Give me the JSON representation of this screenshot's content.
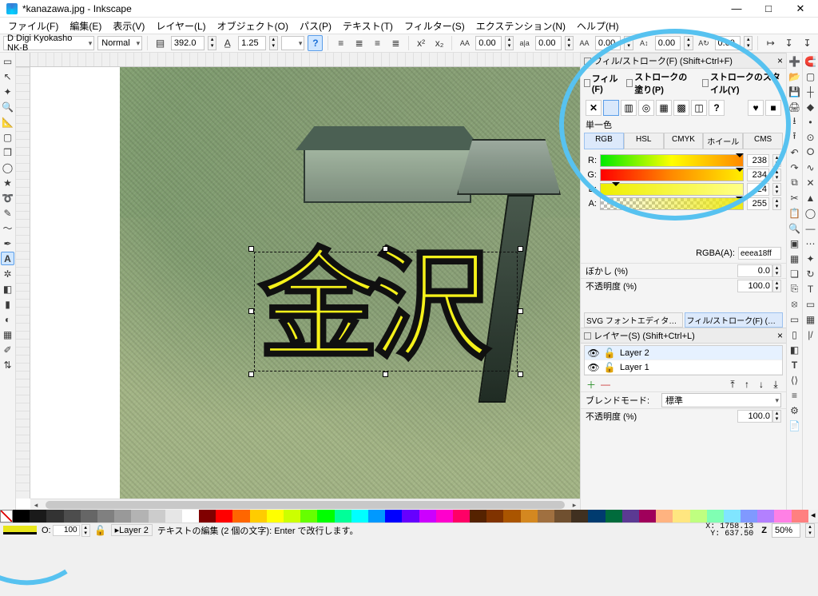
{
  "title": "*kanazawa.jpg - Inkscape",
  "menus": [
    "ファイル(F)",
    "編集(E)",
    "表示(V)",
    "レイヤー(L)",
    "オブジェクト(O)",
    "パス(P)",
    "テキスト(T)",
    "フィルター(S)",
    "エクステンション(N)",
    "ヘルプ(H)"
  ],
  "toolopts": {
    "font_family": "D Digi Kyokasho NK-B",
    "font_style": "Normal",
    "font_size": "392.0",
    "line_height": "1.25",
    "aa_vals": [
      "0.00",
      "0.00",
      "0.00",
      "0.00"
    ]
  },
  "canvas_text": "金沢",
  "fillstroke": {
    "panel_title": "フィル/ストローク(F) (Shift+Ctrl+F)",
    "tab_fill": "フィル(F)",
    "tab_stroke_paint": "ストロークの塗り(P)",
    "tab_stroke_style": "ストロークのスタイル(Y)",
    "single_color": "単一色",
    "modes": [
      "RGB",
      "HSL",
      "CMYK",
      "ホイール",
      "CMS"
    ],
    "r_label": "R:",
    "r_val": "238",
    "g_label": "G:",
    "g_val": "234",
    "b_label": "B:",
    "b_val": "24",
    "a_label": "A:",
    "a_val": "255",
    "rgba_label": "RGBA(A):",
    "rgba_value": "eeea18ff",
    "blur_label": "ぼかし (%)",
    "blur_val": "0.0",
    "opacity_label": "不透明度 (%)",
    "opacity_val": "100.0"
  },
  "docktabs": {
    "svgfont": "SVG フォントエディター…",
    "fsshort": "フィル/ストローク(F) (Shift+Ctrl+F)"
  },
  "layers": {
    "panel_title": "レイヤー(S) (Shift+Ctrl+L)",
    "items": [
      "Layer 2",
      "Layer 1"
    ],
    "blend_label": "ブレンドモード:",
    "blend_value": "標準",
    "opacity_label": "不透明度 (%)",
    "opacity_val": "100.0"
  },
  "status": {
    "opacity_label": "O:",
    "opacity_value": "100",
    "layer_label": "Layer 2",
    "hint": "テキストの編集 (2 個の文字): Enter で改行します。",
    "x": "X: 1758.13",
    "y": "Y:  637.50",
    "zoom": "50%"
  }
}
